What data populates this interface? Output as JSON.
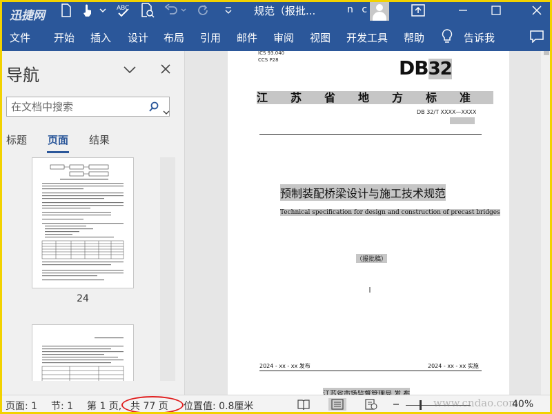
{
  "titlebar": {
    "title": "规范（报批...",
    "user": "n c",
    "watermark": "迅捷网"
  },
  "ribbon": {
    "tabs": [
      "文件",
      "开始",
      "插入",
      "设计",
      "布局",
      "引用",
      "邮件",
      "审阅",
      "视图",
      "开发工具",
      "帮助"
    ],
    "tell_me": "告诉我"
  },
  "nav": {
    "title": "导航",
    "search_placeholder": "在文档中搜索",
    "tabs": [
      "标题",
      "页面",
      "结果"
    ],
    "active_tab": "页面",
    "thumbnails": [
      {
        "page_number": "24"
      }
    ]
  },
  "document": {
    "ics_line1": "ICS  93.040",
    "ics_line2": "CCS  P28",
    "db_prefix": "DB",
    "db_number": "32",
    "province_header": "江苏省地方标准",
    "standard_code": "DB 32/T XXXX—XXXX",
    "title_cn": "预制装配桥梁设计与施工技术规范",
    "title_en": "Technical specification for design and construction of precast bridges",
    "draft_label": "（报批稿）",
    "issue_date": "2024 - xx - xx 发布",
    "impl_date": "2024 - xx - xx 实施",
    "issuer": "江苏省市场监督管理局  发 布"
  },
  "status": {
    "page": "页面: 1",
    "section": "节: 1",
    "page_of_prefix": "第 1 页,",
    "page_total": "共 77 页",
    "position": "位置值: 0.8厘米",
    "zoom": "40%",
    "watermark": "www.cndao.com"
  },
  "colors": {
    "ribbon_blue": "#2b579a",
    "highlight_gray": "#c6c6c6",
    "annotation_red": "#e02020",
    "frame_yellow": "#f2d200"
  }
}
